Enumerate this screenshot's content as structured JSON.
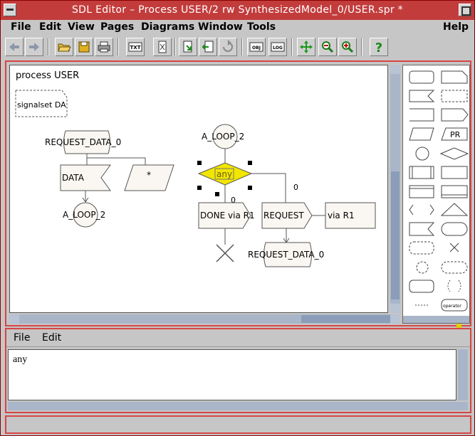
{
  "window": {
    "title": "SDL Editor – Process USER/2 rw SynthesizedModel_0/USER.spr *"
  },
  "menubar": {
    "file": "File",
    "edit": "Edit",
    "view": "View",
    "pages": "Pages",
    "diagrams": "Diagrams",
    "window": "Window",
    "tools": "Tools",
    "help": "Help"
  },
  "toolbar": {
    "txt_label": "TXT",
    "obj_label": "OBJ",
    "log_label": "LOG",
    "pr_label": "PR",
    "help_glyph": "?"
  },
  "diagram": {
    "heading": "process USER",
    "signalset": "signalset DA",
    "left_state": "REQUEST_DATA_0",
    "left_input": "DATA",
    "left_save": "*",
    "left_nextstate": "A_LOOP_2",
    "right_state": "A_LOOP_2",
    "decision": "any",
    "branch_a": "0",
    "branch_b": "0",
    "output_done": "DONE via R1",
    "output_request": "REQUEST",
    "via_label": "via R1",
    "right_nextstate": "REQUEST_DATA_0"
  },
  "palette": {
    "pr_label": "PR",
    "operator_label": "operator"
  },
  "text_editor": {
    "menu_file": "File",
    "menu_edit": "Edit",
    "content": "any"
  },
  "statusbar": {
    "text": ""
  }
}
